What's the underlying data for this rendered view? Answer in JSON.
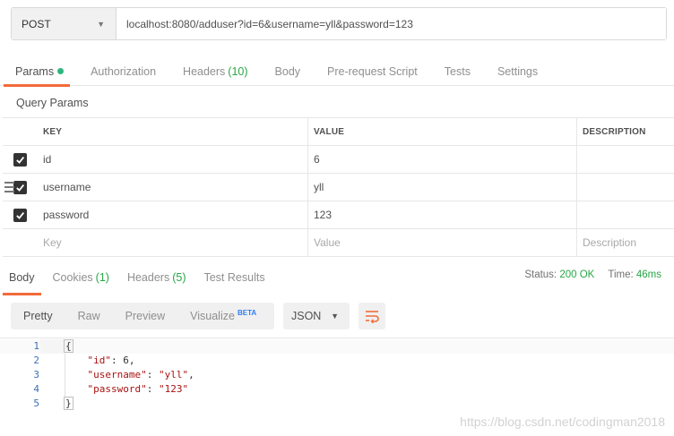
{
  "request": {
    "method": "POST",
    "url": "localhost:8080/adduser?id=6&username=yll&password=123"
  },
  "request_tabs": [
    {
      "label": "Params",
      "count": "",
      "active": true
    },
    {
      "label": "Authorization",
      "count": ""
    },
    {
      "label": "Headers",
      "count": "(10)"
    },
    {
      "label": "Body",
      "count": ""
    },
    {
      "label": "Pre-request Script",
      "count": ""
    },
    {
      "label": "Tests",
      "count": ""
    },
    {
      "label": "Settings",
      "count": ""
    }
  ],
  "section_title": "Query Params",
  "params_table": {
    "headers": {
      "key": "KEY",
      "value": "VALUE",
      "description": "DESCRIPTION"
    },
    "rows": [
      {
        "key": "id",
        "value": "6",
        "description": "",
        "checked": true
      },
      {
        "key": "username",
        "value": "yll",
        "description": "",
        "checked": true
      },
      {
        "key": "password",
        "value": "123",
        "description": "",
        "checked": true
      }
    ],
    "placeholders": {
      "key": "Key",
      "value": "Value",
      "description": "Description"
    }
  },
  "response_tabs": [
    {
      "label": "Body",
      "count": ""
    },
    {
      "label": "Cookies",
      "count": "(1)"
    },
    {
      "label": "Headers",
      "count": "(5)"
    },
    {
      "label": "Test Results",
      "count": ""
    }
  ],
  "status": {
    "label": "Status:",
    "value": "200 OK",
    "time_label": "Time:",
    "time_value": "46ms"
  },
  "body_toolbar": {
    "views": [
      "Pretty",
      "Raw",
      "Preview",
      "Visualize"
    ],
    "beta_badge": "BETA",
    "format": "JSON"
  },
  "code_lines": [
    {
      "num": "1"
    },
    {
      "num": "2",
      "key": "\"id\"",
      "value": "6"
    },
    {
      "num": "3",
      "key": "\"username\"",
      "value": "\"yll\""
    },
    {
      "num": "4",
      "key": "\"password\"",
      "value": "\"123\""
    },
    {
      "num": "5"
    }
  ],
  "watermark": "https://blog.csdn.net/codingman2018",
  "colors": {
    "accent": "#f26b3a",
    "success": "#27a745",
    "beta": "#2f7ef5"
  }
}
